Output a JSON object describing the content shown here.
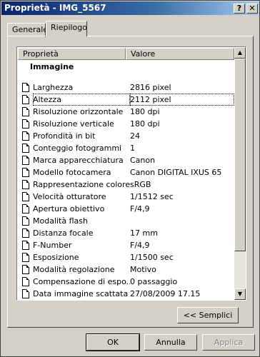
{
  "window": {
    "title": "Proprietà - IMG_5567",
    "help_label": "?",
    "close_label": "✕"
  },
  "tabs": [
    {
      "label": "Generale",
      "active": false
    },
    {
      "label": "Riepilogo",
      "active": true
    }
  ],
  "list": {
    "columns": [
      "Proprietà",
      "Valore"
    ],
    "group_title": "Immagine",
    "rows": [
      {
        "name": "Larghezza",
        "value": "2816 pixel"
      },
      {
        "name": "Altezza",
        "value": "2112 pixel"
      },
      {
        "name": "Risoluzione orizzontale",
        "value": "180 dpi"
      },
      {
        "name": "Risoluzione verticale",
        "value": "180 dpi"
      },
      {
        "name": "Profondità in bit",
        "value": "24"
      },
      {
        "name": "Conteggio fotogrammi",
        "value": "1"
      },
      {
        "name": "Marca apparecchiatura",
        "value": "Canon"
      },
      {
        "name": "Modello fotocamera",
        "value": "Canon DIGITAL IXUS 65"
      },
      {
        "name": "Rappresentazione colore",
        "value": "sRGB"
      },
      {
        "name": "Velocità otturatore",
        "value": "1/1512 sec"
      },
      {
        "name": "Apertura obiettivo",
        "value": "F/4,9"
      },
      {
        "name": "Modalità flash",
        "value": ""
      },
      {
        "name": "Distanza focale",
        "value": "17 mm"
      },
      {
        "name": "F-Number",
        "value": "F/4,9"
      },
      {
        "name": "Esposizione",
        "value": "1/1500 sec"
      },
      {
        "name": "Modalità regolazione",
        "value": "Motivo"
      },
      {
        "name": "Compensazione di espo...",
        "value": "0 passaggio"
      },
      {
        "name": "Data immagine scattata",
        "value": "27/08/2009 17.15"
      }
    ]
  },
  "buttons": {
    "semplici": "<< Semplici",
    "ok": "OK",
    "annulla": "Annulla",
    "applica": "Applica"
  }
}
